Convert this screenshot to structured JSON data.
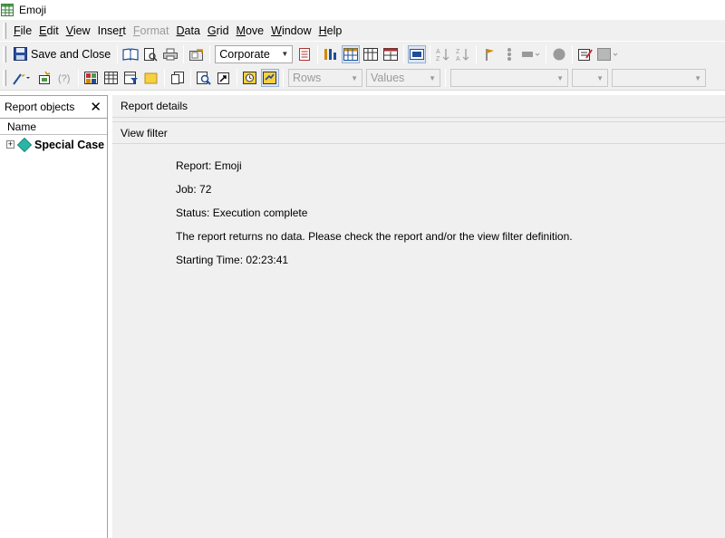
{
  "window": {
    "title": "Emoji"
  },
  "menu": {
    "items": [
      {
        "label": "File",
        "u": "F",
        "rest": "ile",
        "disabled": false
      },
      {
        "label": "Edit",
        "u": "E",
        "rest": "dit",
        "disabled": false
      },
      {
        "label": "View",
        "u": "V",
        "rest": "iew",
        "disabled": false
      },
      {
        "label": "Insert",
        "pre": "Inse",
        "u": "r",
        "rest": "t",
        "disabled": false
      },
      {
        "label": "Format",
        "u": "F",
        "rest": "ormat",
        "disabled": true
      },
      {
        "label": "Data",
        "u": "D",
        "rest": "ata",
        "disabled": false
      },
      {
        "label": "Grid",
        "u": "G",
        "rest": "rid",
        "disabled": false
      },
      {
        "label": "Move",
        "u": "M",
        "rest": "ove",
        "disabled": false
      },
      {
        "label": "Window",
        "u": "W",
        "rest": "indow",
        "disabled": false
      },
      {
        "label": "Help",
        "u": "H",
        "rest": "elp",
        "disabled": false
      }
    ]
  },
  "toolbar": {
    "save_label": "Save and Close",
    "style_combo": "Corporate",
    "rows_combo": "Rows",
    "values_combo": "Values"
  },
  "left_panel": {
    "title": "Report objects",
    "close_glyph": "✕",
    "column_header": "Name",
    "tree": [
      {
        "label": "Special Case",
        "expander": "+"
      }
    ]
  },
  "main": {
    "report_details_label": "Report details",
    "view_filter_label": "View filter",
    "details": {
      "report": "Report: Emoji",
      "job": "Job: 72",
      "status": "Status: Execution complete",
      "message": "The report returns no data. Please check the report and/or the view filter definition.",
      "start_time": "Starting Time: 02:23:41"
    }
  },
  "colors": {
    "panel_bg": "#f0f0f0",
    "tree_icon": "#2ab5a5",
    "accent": "#1f4e99"
  }
}
